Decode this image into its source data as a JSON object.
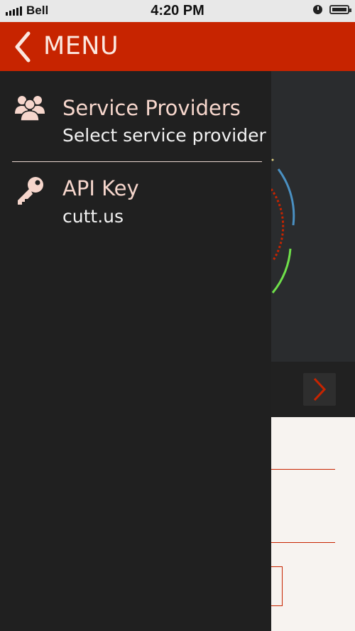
{
  "status_bar": {
    "carrier": "Bell",
    "time": "4:20 PM"
  },
  "header": {
    "title": "MENU",
    "back_icon": "chevron-left-icon"
  },
  "menu": {
    "items": [
      {
        "title": "Service Providers",
        "subtitle": "Select service provider",
        "icon": "users-icon"
      },
      {
        "title": "API Key",
        "subtitle": "cutt.us",
        "icon": "key-icon"
      }
    ]
  },
  "colors": {
    "accent": "#c72400",
    "drawer_bg": "#202020",
    "title_text": "#f6d6cc",
    "ring_blue": "#4a90c2",
    "ring_green": "#6fe04a",
    "ring_red": "#c72400"
  },
  "background": {
    "next_icon": "chevron-right-icon"
  }
}
